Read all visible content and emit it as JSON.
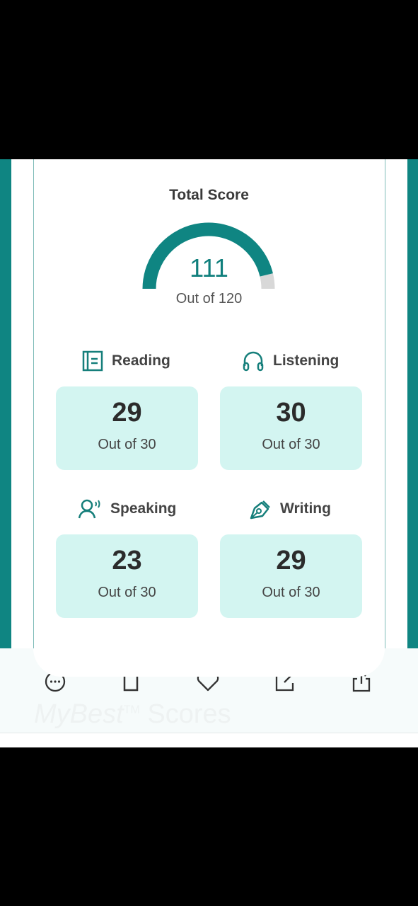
{
  "total": {
    "title": "Total Score",
    "score": "111",
    "out_of": "Out of 120",
    "fraction": 0.925
  },
  "sections": [
    {
      "label": "Reading",
      "icon": "book-icon",
      "score": "29",
      "out_of": "Out of 30"
    },
    {
      "label": "Listening",
      "icon": "headphones-icon",
      "score": "30",
      "out_of": "Out of 30"
    },
    {
      "label": "Speaking",
      "icon": "speaking-person-icon",
      "score": "23",
      "out_of": "Out of 30"
    },
    {
      "label": "Writing",
      "icon": "pen-nib-icon",
      "score": "29",
      "out_of": "Out of 30"
    }
  ],
  "watermark": {
    "brand": "MyBest",
    "tm": "TM",
    "word": "Scores"
  },
  "toolbar": [
    "more-icon",
    "trash-icon",
    "heart-icon",
    "edit-icon",
    "share-icon"
  ],
  "colors": {
    "accent": "#0f8582",
    "card_bg": "#d3f5f1",
    "gauge_rest": "#d8d8d8"
  }
}
